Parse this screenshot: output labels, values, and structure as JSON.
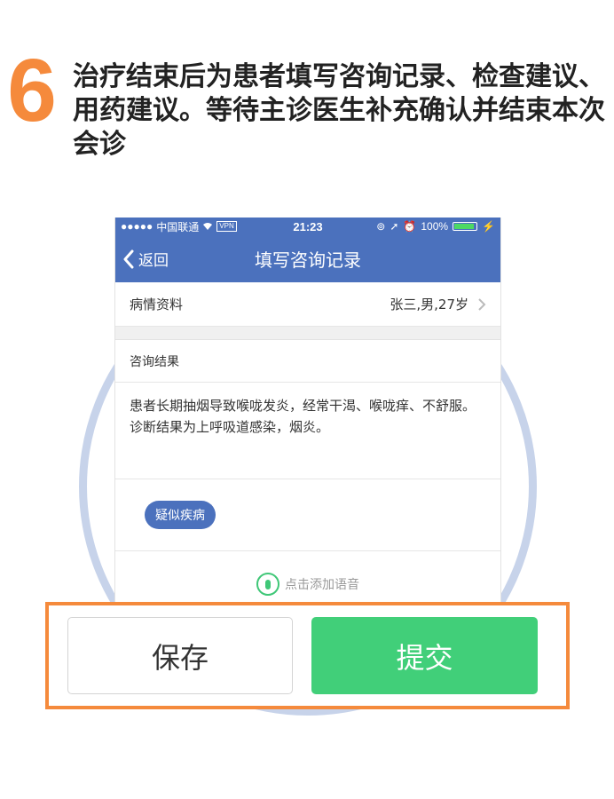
{
  "step": {
    "number": "6",
    "heading": "治疗结束后为患者填写咨询记录、检查建议、用药建议。等待主诊医生补充确认并结束本次会诊"
  },
  "status_bar": {
    "carrier": "中国联通",
    "vpn": "VPN",
    "time": "21:23",
    "battery": "100%"
  },
  "nav": {
    "back_label": "返回",
    "title": "填写咨询记录"
  },
  "case_info": {
    "label": "病情资料",
    "value": "张三,男,27岁"
  },
  "consult": {
    "label": "咨询结果",
    "text": "患者长期抽烟导致喉咙发炎，经常干渴、喉咙痒、不舒服。诊断结果为上呼吸道感染，烟炎。"
  },
  "tag": "疑似疾病",
  "voice_label": "点击添加语音",
  "actions": {
    "save": "保存",
    "submit": "提交"
  },
  "colors": {
    "accent_orange": "#f58a3c",
    "nav_blue": "#4b71bd",
    "submit_green": "#41cf79",
    "circle": "#c7d3ea"
  }
}
